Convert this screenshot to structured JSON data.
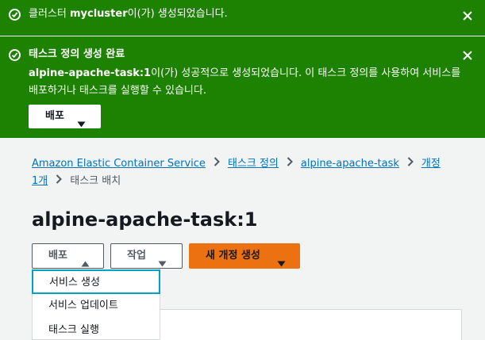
{
  "flash_created": {
    "prefix": "클러스터 ",
    "name": "mycluster",
    "suffix": "이(가) 생성되었습니다."
  },
  "flash_task": {
    "title": "태스크 정의 생성 완료",
    "body_name": "alpine-apache-task:1",
    "body_text": "이(가) 성공적으로 생성되었습니다. 이 태스크 정의를 사용하여 서비스를 배포하거나 태스크를 실행할 수 있습니다.",
    "deploy_button": "배포"
  },
  "breadcrumb": {
    "items": [
      "Amazon Elastic Container Service",
      "태스크 정의",
      "alpine-apache-task",
      "개정 1개"
    ],
    "current": "태스크 배치"
  },
  "page_title": "alpine-apache-task:1",
  "actions": {
    "deploy": "배포",
    "action": "작업",
    "new_revision": "새 개정 생성"
  },
  "deploy_menu": [
    "서비스 생성",
    "서비스 업데이트",
    "태스크 실행"
  ],
  "colors": {
    "flash_green": "#1d8102",
    "link": "#0073bb",
    "primary": "#ec7211",
    "focus": "#00a1c9"
  }
}
